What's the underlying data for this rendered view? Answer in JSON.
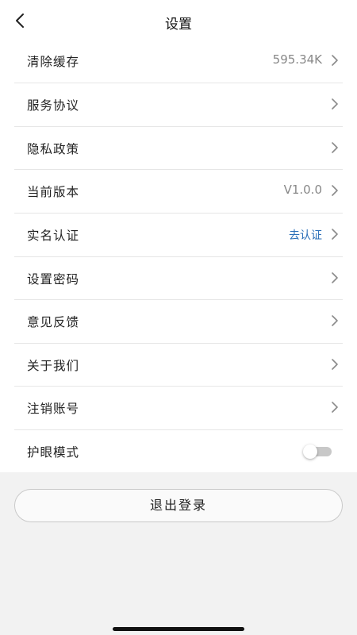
{
  "header": {
    "title": "设置"
  },
  "settings": {
    "items": [
      {
        "label": "清除缓存",
        "value": "595.34K"
      },
      {
        "label": "服务协议",
        "value": ""
      },
      {
        "label": "隐私政策",
        "value": ""
      },
      {
        "label": "当前版本",
        "value": "V1.0.0"
      },
      {
        "label": "实名认证",
        "value": "去认证"
      },
      {
        "label": "设置密码",
        "value": ""
      },
      {
        "label": "意见反馈",
        "value": ""
      },
      {
        "label": "关于我们",
        "value": ""
      },
      {
        "label": "注销账号",
        "value": ""
      },
      {
        "label": "护眼模式",
        "toggle_on": false
      }
    ]
  },
  "footer": {
    "logout_label": "退出登录"
  },
  "colors": {
    "link": "#2b6fb8",
    "page_background": "#f2f2f2"
  },
  "icons": {
    "back": "chevron-left-icon",
    "row_arrow": "chevron-right-icon"
  }
}
